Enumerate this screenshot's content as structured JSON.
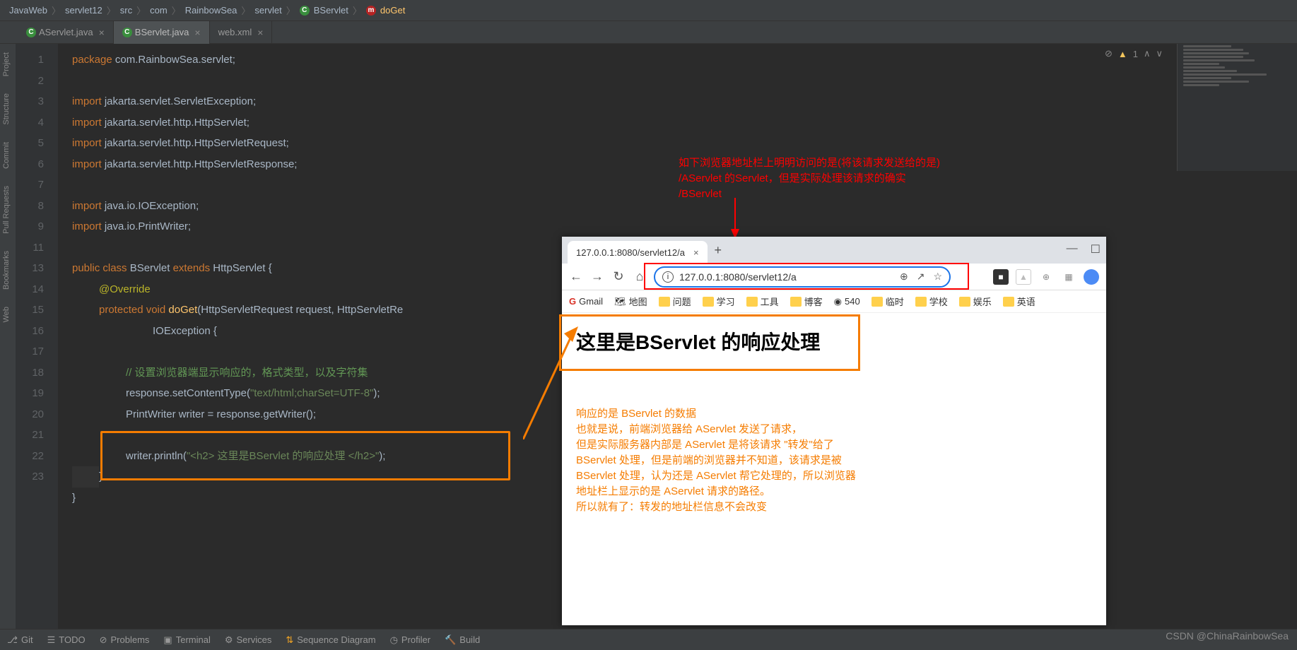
{
  "breadcrumb": {
    "items": [
      "JavaWeb",
      "servlet12",
      "src",
      "com",
      "RainbowSea",
      "servlet",
      "BServlet",
      "doGet"
    ]
  },
  "tabs": [
    {
      "label": "AServlet.java",
      "active": false
    },
    {
      "label": "BServlet.java",
      "active": true
    },
    {
      "label": "web.xml",
      "active": false
    }
  ],
  "side": {
    "tabs": [
      "Project",
      "Structure",
      "Commit",
      "Pull Requests",
      "Bookmarks",
      "Web"
    ]
  },
  "gutter": {
    "lines": [
      "1",
      "2",
      "3",
      "4",
      "5",
      "6",
      "7",
      "8",
      "9",
      "",
      "11",
      "",
      "13",
      "14",
      "15",
      "16",
      "17",
      "18",
      "19",
      "20",
      "21",
      "22",
      "23",
      ""
    ]
  },
  "code": {
    "l1_kw": "package ",
    "l1_rest": "com.RainbowSea.servlet;",
    "l3_kw": "import ",
    "l3_rest": "jakarta.servlet.ServletException;",
    "l4_kw": "import ",
    "l4_rest": "jakarta.servlet.http.HttpServlet;",
    "l5_kw": "import ",
    "l5_rest": "jakarta.servlet.http.HttpServletRequest;",
    "l6_kw": "import ",
    "l6_rest": "jakarta.servlet.http.HttpServletResponse;",
    "l8_kw": "import ",
    "l8_rest": "java.io.IOException;",
    "l9_kw": "import ",
    "l9_rest": "java.io.PrintWriter;",
    "l11_a": "public class ",
    "l11_b": "BServlet ",
    "l11_c": "extends ",
    "l11_d": "HttpServlet {",
    "l12": "@Override",
    "l13_a": "protected void ",
    "l13_b": "doGet",
    "l13_c": "(HttpServletRequest request, HttpServletRe",
    "l14_a": "IOException ",
    "l14_b": "{",
    "l16": "// 设置浏览器端显示响应的，格式类型，以及字符集",
    "l17_a": "response.setContentType(",
    "l17_b": "\"text/html;charSet=UTF-8\"",
    "l17_c": ");",
    "l18": "PrintWriter writer = response.getWriter();",
    "l20_a": "writer.println(",
    "l20_b": "\"<h2> 这里是BServlet 的响应处理 </h2>\"",
    "l20_c": ");",
    "l22": "}",
    "l23": "}"
  },
  "indicators": {
    "warn": "1"
  },
  "annotation_red": {
    "l1": "如下浏览器地址栏上明明访问的是(将该请求发送给的是)",
    "l2": "/AServlet 的Servlet，但是实际处理该请求的确实",
    "l3": "/BServlet"
  },
  "browser": {
    "tab_title": "127.0.0.1:8080/servlet12/a",
    "url": "127.0.0.1:8080/servlet12/a",
    "bookmarks": [
      "Gmail",
      "地图",
      "问题",
      "学习",
      "工具",
      "博客",
      "540",
      "临时",
      "学校",
      "娱乐",
      "英语"
    ],
    "page_heading": "这里是BServlet 的响应处理"
  },
  "annotation_orange": {
    "l1": "响应的是 BServlet 的数据",
    "l2": "也就是说，前端浏览器给 AServlet 发送了请求，",
    "l3": "但是实际服务器内部是 AServlet 是将该请求 \"转发\"给了",
    "l4": "BServlet 处理，但是前端的浏览器并不知道，该请求是被",
    "l5": "BServlet 处理，认为还是 AServlet 帮它处理的，所以浏览器",
    "l6": "地址栏上显示的是 AServlet 请求的路径。",
    "l7": "所以就有了：转发的地址栏信息不会改变"
  },
  "bottom": {
    "items": [
      "Git",
      "TODO",
      "Problems",
      "Terminal",
      "Services",
      "Sequence Diagram",
      "Profiler",
      "Build"
    ]
  },
  "watermark": "CSDN @ChinaRainbowSea",
  "icon_labels": {
    "c": "C",
    "m": "m",
    "close": "×",
    "plus": "+",
    "info": "i",
    "star": "☆",
    "share": "↗",
    "zoom": "⊕",
    "minimize": "—",
    "maximize": "☐",
    "home": "⌂",
    "back": "←",
    "forward": "→",
    "reload": "↻",
    "git": "⎇",
    "warn": "▲",
    "eye": "⊘",
    "up": "∧",
    "down": "∨"
  }
}
